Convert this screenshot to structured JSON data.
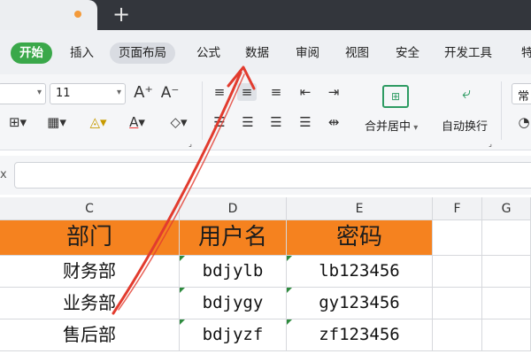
{
  "tab": {
    "add_symbol": "+"
  },
  "menu": {
    "start": "开始",
    "insert": "插入",
    "page_layout": "页面布局",
    "formula": "公式",
    "data": "数据",
    "review": "审阅",
    "view": "视图",
    "security": "安全",
    "dev_tools": "开发工具",
    "more": "特"
  },
  "ribbon": {
    "font_size": "11",
    "merge_center": "合并居中",
    "auto_wrap": "自动换行",
    "style_cut": "常"
  },
  "formula_bar": {
    "name_box_tail": "x"
  },
  "sheet": {
    "columns": [
      "C",
      "D",
      "E",
      "F",
      "G"
    ],
    "header_row": [
      "部门",
      "用户名",
      "密码"
    ],
    "rows": [
      [
        "财务部",
        "bdjylb",
        "lb123456"
      ],
      [
        "业务部",
        "bdjygy",
        "gy123456"
      ],
      [
        "售后部",
        "bdjyzf",
        "zf123456"
      ]
    ]
  },
  "colors": {
    "start_button": "#3aa84a",
    "header_fill": "#f5821f",
    "annotation_arrow": "#e23b2e",
    "tab_modified_dot": "#f39a3a"
  }
}
